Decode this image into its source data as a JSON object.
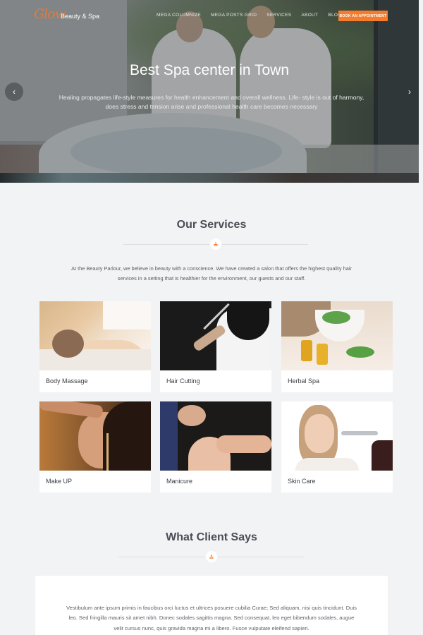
{
  "header": {
    "logo_script": "Glow",
    "logo_text": "Beauty & Spa",
    "nav": [
      {
        "label": "MEGA COLUMNIZE"
      },
      {
        "label": "MEGA POSTS GRID"
      },
      {
        "label": "SERVICES"
      },
      {
        "label": "ABOUT"
      },
      {
        "label": "BLOG"
      }
    ],
    "cta_label": "BOOK AN APPOINTMENT",
    "accent_color": "#f47c2c"
  },
  "hero": {
    "title": "Best Spa center in Town",
    "description": "Healing propagates life-style measures for health enhancement and overall wellness. Life- style is out of harmony, does stress and tension arise and professional health care becomes necessary",
    "prev_icon": "chevron-left-icon",
    "next_icon": "chevron-right-icon",
    "prev_glyph": "‹",
    "next_glyph": "›"
  },
  "services": {
    "title": "Our Services",
    "divider_icon": "lotus-icon",
    "description": "At the Beauty Parlour, we believe in beauty with a conscience. We have created a salon that offers the highest quality hair services in a setting that is healthier for the environment, our guests and our staff.",
    "items": [
      {
        "label": "Body Massage"
      },
      {
        "label": "Hair Cutting"
      },
      {
        "label": "Herbal Spa"
      },
      {
        "label": "Make UP"
      },
      {
        "label": "Manicure"
      },
      {
        "label": "Skin Care"
      }
    ]
  },
  "testimonials": {
    "title": "What Client Says",
    "divider_icon": "lotus-icon",
    "text": "Vestibulum ante ipsum primis in faucibus orci luctus et ultrices posuere cubilia Curae; Sed aliquam, nisi quis tincidunt. Duis leo. Sed fringilla mauris sit amet nibh. Donec sodales sagittis magna. Sed consequat, leo eget bibendum sodales, augue velit cursus nunc, quis gravida magna mi a libero. Fusce vulputate eleifend sapien."
  }
}
